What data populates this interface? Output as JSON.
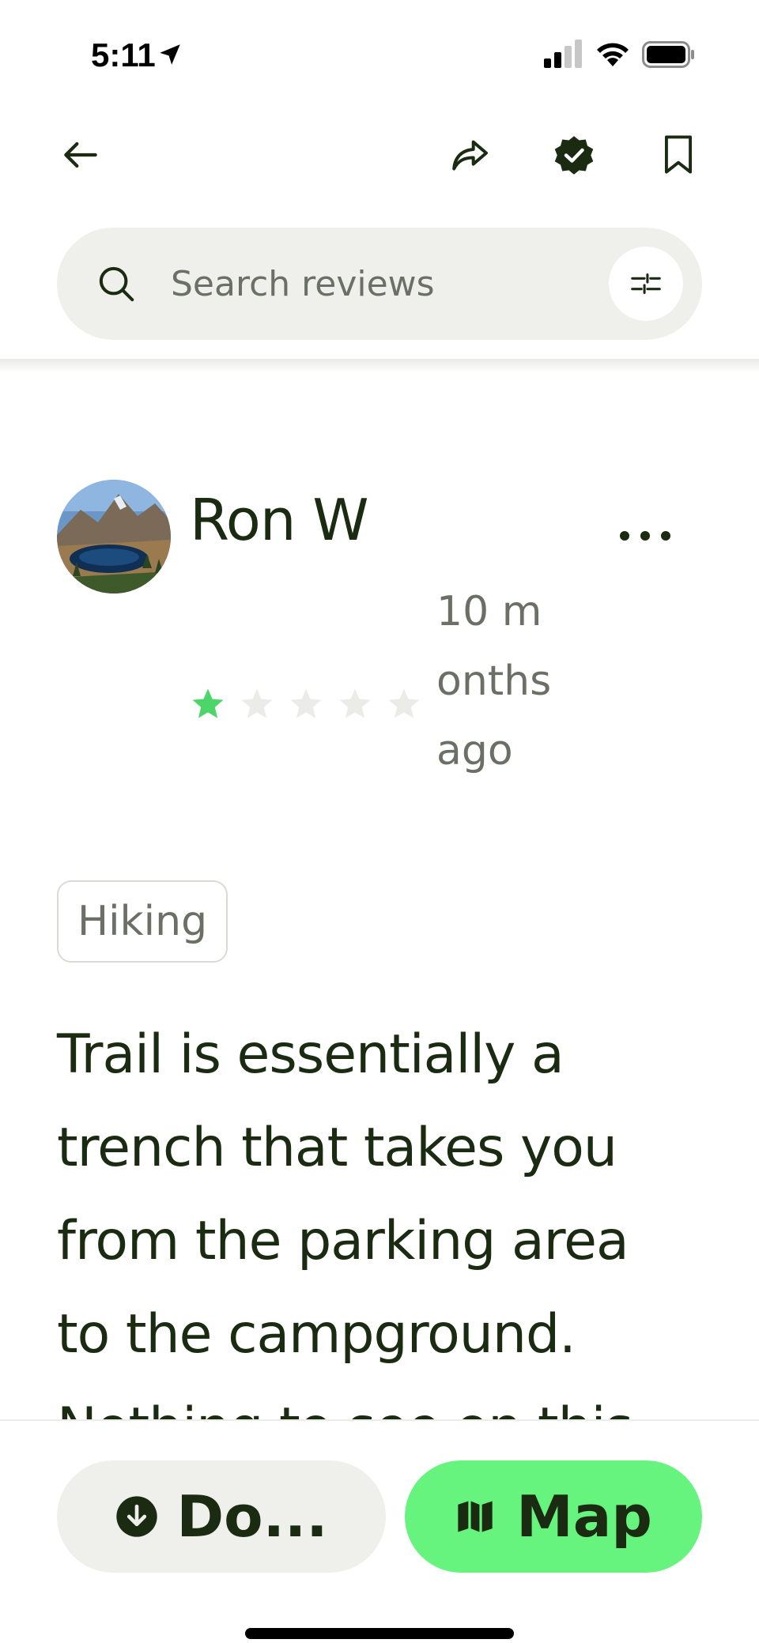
{
  "status_bar": {
    "time": "5:11"
  },
  "search": {
    "placeholder": "Search reviews"
  },
  "review": {
    "reviewer_name": "Ron W",
    "rating": 1,
    "max_rating": 5,
    "age": "10 months ago",
    "activity_tag": "Hiking",
    "text": "Trail is essentially a trench that takes you from the parking area to the campground. Nothing to see on this"
  },
  "bottom_bar": {
    "download_label": "Do...",
    "map_label": "Map"
  },
  "colors": {
    "accent_green": "#66f47e",
    "star_filled": "#4cd66a",
    "star_empty": "#ebebe8",
    "text_dark": "#1a2b12",
    "text_muted": "#6b6f65",
    "chip_bg": "#efefeb"
  },
  "icons": {
    "back": "arrow-left-icon",
    "share": "share-icon",
    "verified": "verified-badge-icon",
    "bookmark": "bookmark-icon",
    "search": "search-icon",
    "filter": "sliders-icon",
    "download": "download-icon",
    "map": "map-icon"
  }
}
